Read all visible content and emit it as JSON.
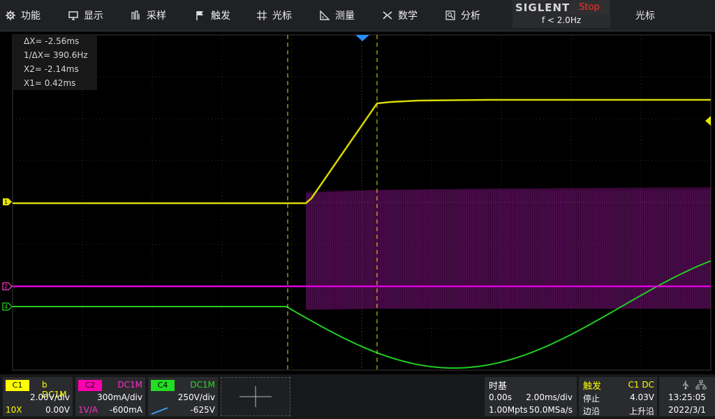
{
  "menu": [
    {
      "label": "功能",
      "icon": "gear-icon"
    },
    {
      "label": "显示",
      "icon": "monitor-icon"
    },
    {
      "label": "采样",
      "icon": "sampling-icon"
    },
    {
      "label": "触发",
      "icon": "flag-icon"
    },
    {
      "label": "光标",
      "icon": "crosshair-icon"
    },
    {
      "label": "测量",
      "icon": "ruler-triangle-icon"
    },
    {
      "label": "数学",
      "icon": "math-x-icon"
    },
    {
      "label": "分析",
      "icon": "analysis-icon"
    }
  ],
  "brand": {
    "logo": "SIGLENT",
    "status": "Stop",
    "freq": "f < 2.0Hz"
  },
  "cursor_menu": {
    "label": "光标",
    "icon": "document-icon"
  },
  "readout": {
    "dx": "ΔX= -2.56ms",
    "inv_dx": "1/ΔX= 390.6Hz",
    "x2": "X2= -2.14ms",
    "x1": "X1= 0.42ms"
  },
  "channels": {
    "c1": {
      "tag": "C1",
      "coupling": "b DC1M",
      "vdiv": "2.00V/div",
      "probe": "10X",
      "offset": "0.00V",
      "color": "#ffff00"
    },
    "c2": {
      "tag": "C2",
      "coupling": "DC1M",
      "vdiv": "300mA/div",
      "probe": "1V/A",
      "offset": "-600mA",
      "color": "#ff00b0"
    },
    "c4": {
      "tag": "C4",
      "coupling": "DC1M",
      "vdiv": "250V/div",
      "offset": "-625V",
      "color": "#22dd22"
    }
  },
  "timebase": {
    "title": "时基",
    "delay": "0.00s",
    "tdiv": "2.00ms/div",
    "memory": "1.00Mpts",
    "srate": "50.0MSa/s"
  },
  "trigger": {
    "title": "触发",
    "source": "C1 DC",
    "mode": "停止",
    "level": "4.03V",
    "type": "边沿",
    "slope": "上升沿"
  },
  "clock": {
    "time": "13:25:05",
    "date": "2022/3/1"
  },
  "colors": {
    "ch1": "#e6e600",
    "ch2": "#dd00dd",
    "ch4": "#22cc22",
    "cursor": "#e6e600",
    "trigger_marker": "#2a8fff"
  }
}
